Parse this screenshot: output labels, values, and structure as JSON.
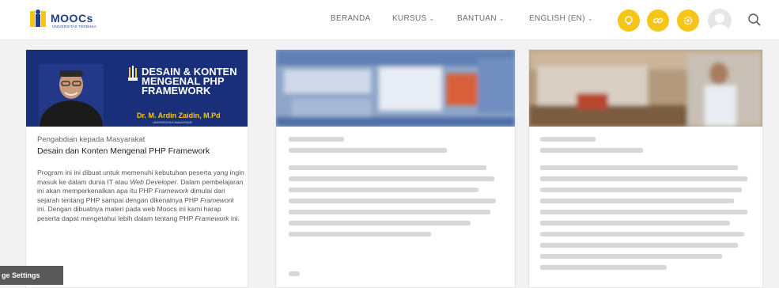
{
  "header": {
    "logo_text": "MOOCs",
    "logo_sub": "UNIVERSITAS TERBUKA",
    "nav": [
      {
        "label": "BERANDA"
      },
      {
        "label": "KURSUS"
      },
      {
        "label": "BANTUAN"
      },
      {
        "label": "ENGLISH (EN)"
      }
    ],
    "icons": [
      "lightbulb-icon",
      "link-icon",
      "gear-icon"
    ],
    "accent": "#f5c518"
  },
  "course": {
    "banner_title": "DESAIN & KONTEN MENGENAL PHP FRAMEWORK",
    "banner_name": "Dr. M. Ardin Zaidin, M.Pd",
    "banner_inst": "UNIVERSITAS MAKASSAR",
    "category": "Pengabdian kepada Masyarakat",
    "title": "Desain dan Konten Mengenal PHP Framework",
    "desc_1": "Program ini ini dibuat untuk memenuhi kebutuhan peserta yang ingin masuk ke dalam dunia IT atau ",
    "desc_2": "Web Developer",
    "desc_3": ". Dalam pembelajaran ini akan memperkenalkan apa itu PHP ",
    "desc_4": "Framework",
    "desc_5": " dimulai dari sejarah tentang PHP sampai dengan dikenalnya PHP ",
    "desc_6": "Framework",
    "desc_7": " ini. Dengan dibuatnya materi pada web Moocs ini kami harap peserta dapat mengetahui lebih dalam tentang PHP ",
    "desc_8": "Framework",
    "desc_9": " ini."
  },
  "footer": {
    "page_settings": "ge Settings"
  }
}
